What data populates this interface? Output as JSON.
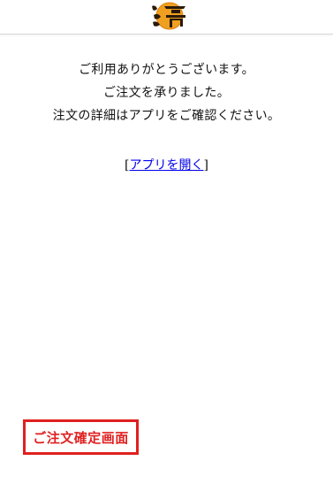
{
  "header": {
    "logo_text": "どんどん亭"
  },
  "message": {
    "lines": [
      "ご利用ありがとうございます。",
      "ご注文を承りました。",
      "注文の詳細はアプリをご確認ください。"
    ]
  },
  "link": {
    "bracket_open": "[",
    "label": "アプリを開く",
    "bracket_close": "]",
    "color": "#0000ee"
  },
  "caption": {
    "label": "ご注文確定画面",
    "color": "#e02020"
  }
}
